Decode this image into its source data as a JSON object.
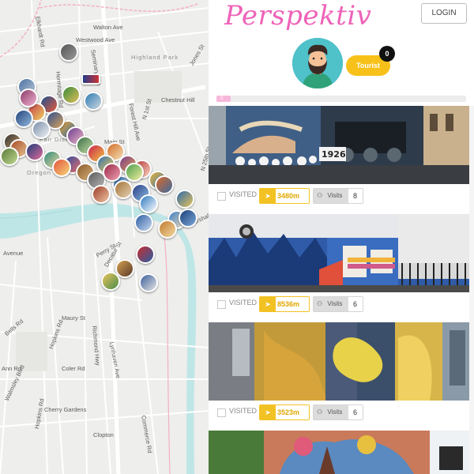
{
  "map": {
    "road_labels": [
      "Walton Ave",
      "Westwood Ave",
      "Seminary Ave",
      "Highland Park",
      "Hermitage Rd",
      "Chestnut Hill",
      "N 1st St",
      "N 25th St",
      "Main St",
      "Perry St",
      "Decatur St",
      "Richmond Hwy",
      "Maury St",
      "Bells Rd",
      "Hopkins Rd",
      "Coler Rd",
      "Lynhaven Ave",
      "Cherry Gardens",
      "Commerce Rd",
      "Clopton",
      "Walmsley Blvd",
      "Hopkins Rd",
      "Fan District",
      "Oregon Hill",
      "Ann Rd",
      "Forest Hill Ave",
      "Avenue",
      "Elkhardt Rd",
      "Jones St",
      "Marshall"
    ],
    "pin_count": 46,
    "river_color": "#bfe6e6",
    "road_color": "#ffffff",
    "highway_color": "#f3b0c4"
  },
  "header": {
    "logo": "Perspektiv",
    "login_label": "LOGIN"
  },
  "profile": {
    "badge_label": "Tourist",
    "badge_count": "0",
    "progress_label": "0",
    "progress_value": 0
  },
  "cards": [
    {
      "visited_label": "VISITED",
      "distance": "3480m",
      "visits_label": "Visits",
      "visits_count": "8",
      "image": "mural-train-1926"
    },
    {
      "visited_label": "VISITED",
      "distance": "8536m",
      "visits_label": "Visits",
      "visits_count": "6",
      "image": "mural-blue-house"
    },
    {
      "visited_label": "VISITED",
      "distance": "3523m",
      "visits_label": "Visits",
      "visits_count": "6",
      "image": "mural-abstract-wall"
    },
    {
      "image": "mural-colorful-tree"
    }
  ],
  "colors": {
    "brand_pink": "#ee63b8",
    "accent_yellow": "#f2c224",
    "avatar_bg": "#4fc1c9"
  },
  "icons": [
    "location-arrow-icon",
    "walk-icon"
  ]
}
